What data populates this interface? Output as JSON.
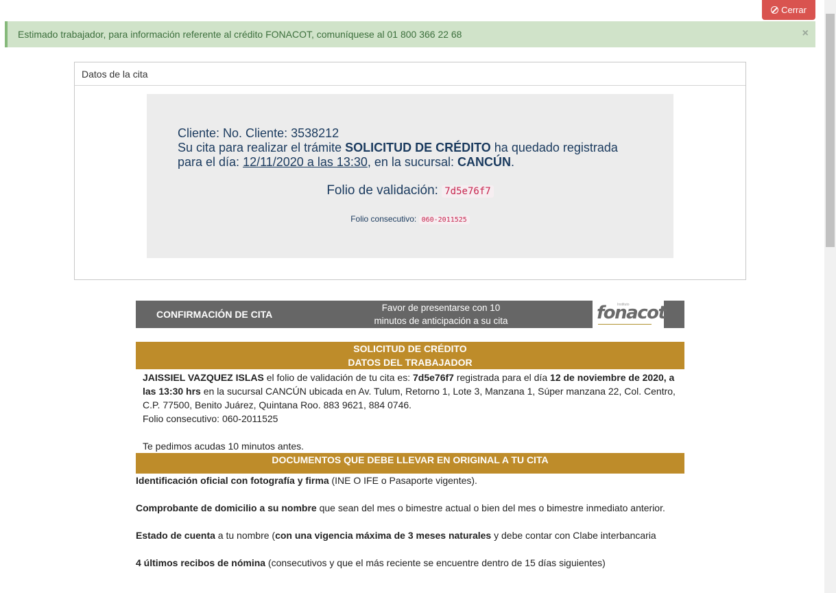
{
  "close_button": {
    "label": "Cerrar",
    "icon": "ban-icon",
    "color": "#d9534f"
  },
  "alert": {
    "text": "Estimado trabajador, para información referente al crédito FONACOT, comuníquese al 01 800 366 22 68",
    "close": "×"
  },
  "panel": {
    "title": "Datos de la cita",
    "cliente": "Cliente: No. Cliente: 3538212",
    "cita_prefix": "Su cita para realizar el trámite ",
    "tramite": "SOLICITUD DE CRÉDITO",
    "cita_suffix": " ha quedado registrada",
    "dia_prefix": "para el día: ",
    "fecha": "12/11/2020 a las 13:30",
    "sucursal_prefix": ", en la sucursal: ",
    "sucursal": "CANCÚN",
    "dot": ".",
    "folio_label": "Folio de validación:",
    "folio": "7d5e76f7",
    "consecutivo_label": "Folio consecutivo:",
    "consecutivo": "060-2011525"
  },
  "confirmacion": {
    "title": "CONFIRMACIÓN DE CITA",
    "note_line1": "Favor de presentarse con 10",
    "note_line2": "minutos de anticipación a su cita",
    "logo_text": "fonacot",
    "logo_small": "Instituto"
  },
  "solicitud": {
    "title1": "SOLICITUD DE CRÉDITO",
    "title2": "DATOS DEL TRABAJADOR",
    "name": "JAISSIEL VAZQUEZ ISLAS",
    "t1": " el folio de validación de tu cita es: ",
    "folio": "7d5e76f7",
    "t2": " registrada para el día ",
    "fecha": "12 de noviembre de 2020, a las 13:30 hrs",
    "t3": " en la sucursal CANCÚN ubicada en Av. Tulum, Retorno 1, Lote 3, Manzana 1, Súper manzana 22, Col. Centro, C.P. 77500, Benito Juárez, Quintana Roo. 883 9621, 884 0746.",
    "consecutivo": "Folio consecutivo: 060-2011525",
    "aviso": "Te pedimos acudas 10 minutos antes."
  },
  "documentos": {
    "title": "DOCUMENTOS QUE DEBE LLEVAR EN ORIGINAL A TU CITA",
    "items": [
      {
        "bold": "Identificación oficial con fotografía y firma",
        "rest": " (INE O IFE o Pasaporte vigentes)."
      },
      {
        "bold": "Comprobante de domicilio a su nombre",
        "rest": " que sean del mes o bimestre actual o bien del mes o bimestre inmediato anterior."
      },
      {
        "pre": "Estado de cuenta",
        "mid": " a tu nombre (",
        "bold": "con una vigencia máxima de 3 meses naturales",
        "rest": " y debe contar con Clabe interbancaria"
      },
      {
        "bold": "4 últimos recibos de nómina",
        "rest": " (consecutivos y que el más reciente se encuentre dentro de 15 días siguientes)"
      }
    ]
  }
}
